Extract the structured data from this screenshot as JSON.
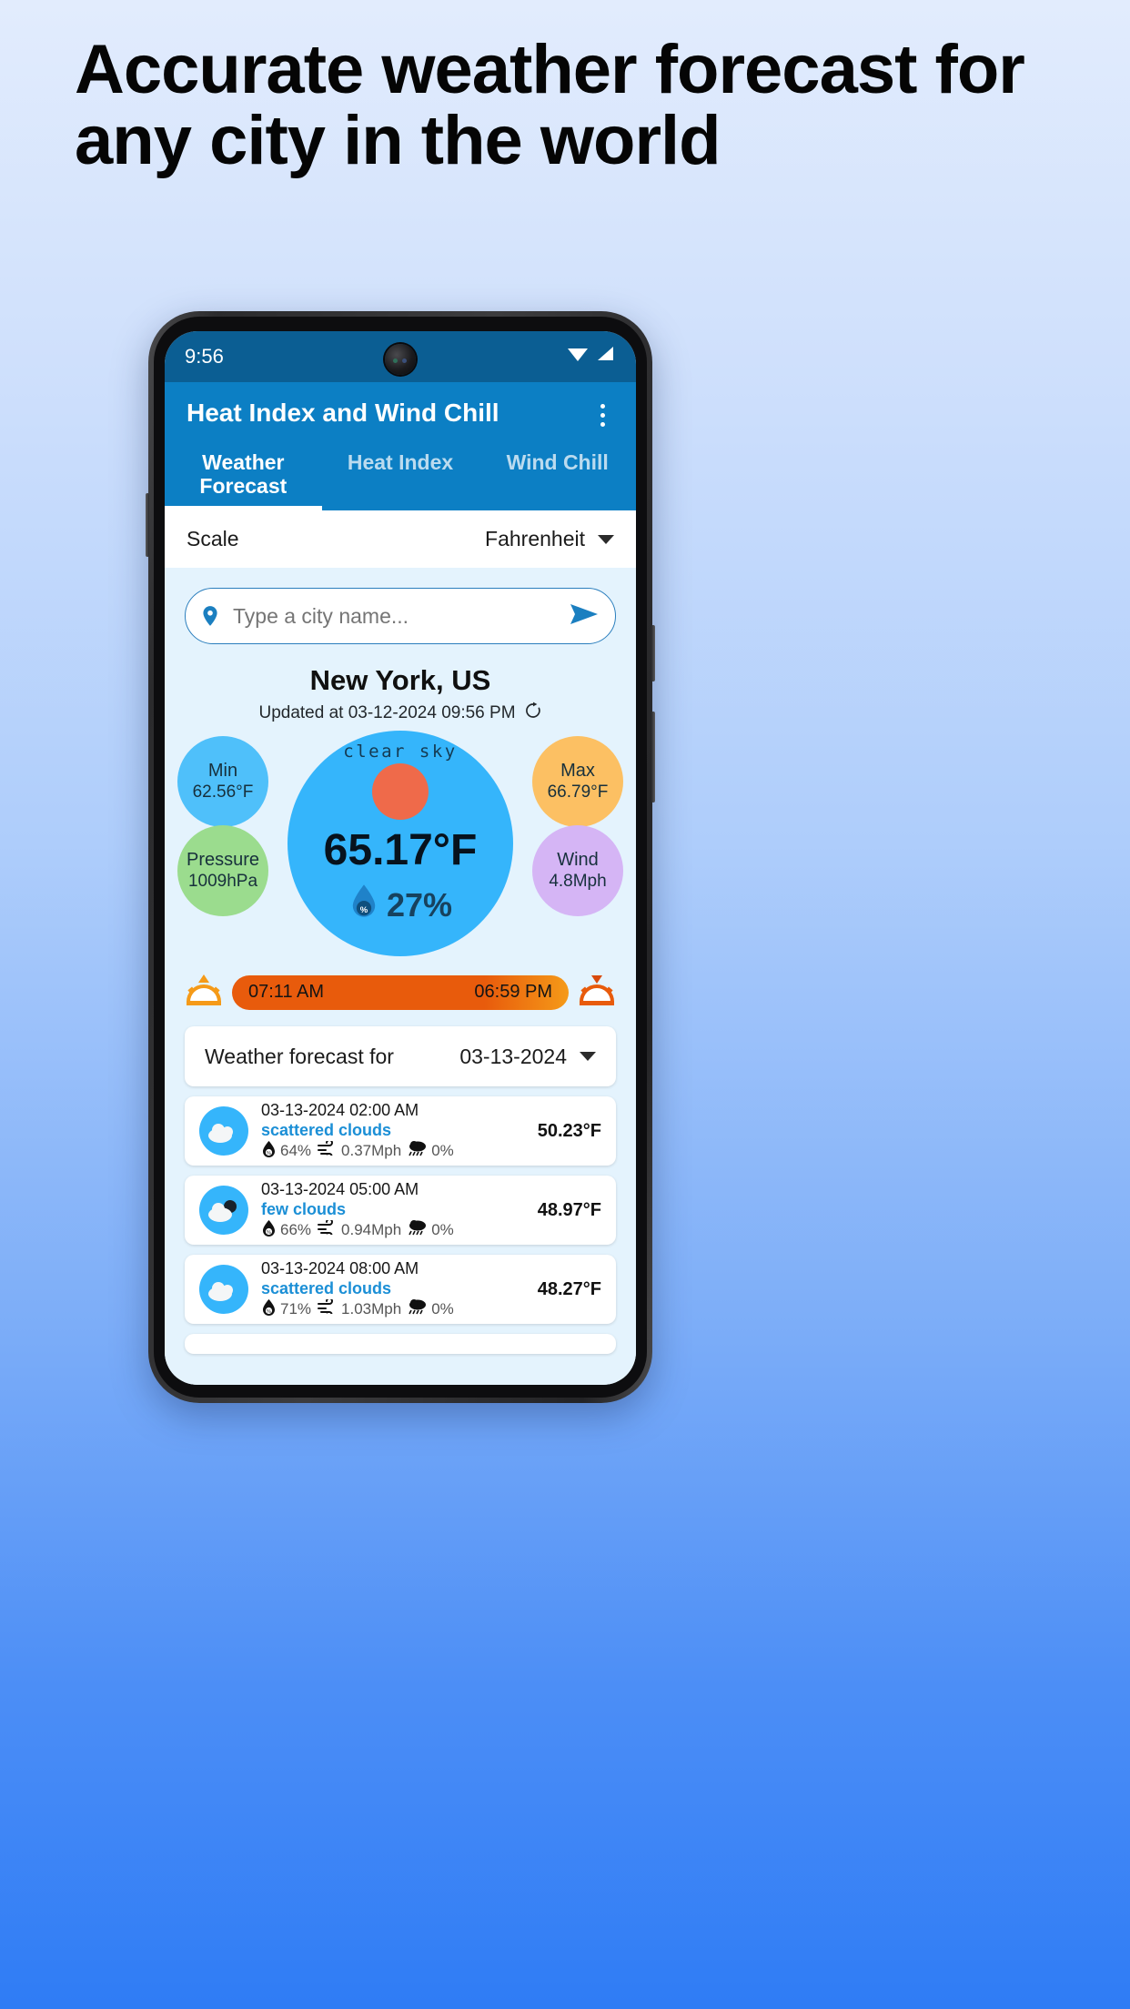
{
  "headline": "Accurate weather forecast for any city in the world",
  "phone": {
    "status": {
      "time": "9:56",
      "wifi_icon": "wifi-icon",
      "signal_icon": "cellular-signal-icon"
    },
    "appbar": {
      "title": "Heat Index and Wind Chill",
      "overflow_icon": "overflow-menu-icon"
    },
    "tabs": [
      {
        "label": "Weather Forecast",
        "active": true
      },
      {
        "label": "Heat Index",
        "active": false
      },
      {
        "label": "Wind Chill",
        "active": false
      }
    ],
    "scale_row": {
      "label": "Scale",
      "value": "Fahrenheit",
      "caret_icon": "chevron-down-icon"
    },
    "search": {
      "placeholder": "Type a city name...",
      "value": "",
      "pin_icon": "location-pin-icon",
      "send_icon": "send-icon"
    },
    "current": {
      "city": "New York, US",
      "updated": "Updated at 03-12-2024 09:56 PM",
      "refresh_icon": "refresh-icon",
      "condition": "clear sky",
      "temperature": "65.17°F",
      "humidity": "27%",
      "humidity_icon": "humidity-drop-icon",
      "bubbles": [
        {
          "title": "Min",
          "value": "62.56°F",
          "color": "#4fc0fa"
        },
        {
          "title": "Max",
          "value": "66.79°F",
          "color": "#fcc063"
        },
        {
          "title": "Pressure",
          "value": "1009hPa",
          "color": "#9bdc8e"
        },
        {
          "title": "Wind",
          "value": "4.8Mph",
          "color": "#d5b5f5"
        }
      ]
    },
    "sun": {
      "sunrise": "07:11 AM",
      "sunset": "06:59 PM",
      "sunrise_icon": "sunrise-icon",
      "sunset_icon": "sunset-icon"
    },
    "forecast_selector": {
      "label": "Weather forecast for",
      "date": "03-13-2024",
      "caret_icon": "chevron-down-icon"
    },
    "forecast_rows": [
      {
        "datetime": "03-13-2024 02:00 AM",
        "description": "scattered clouds",
        "humidity": "64%",
        "wind": "0.37Mph",
        "precip": "0%",
        "temp": "50.23°F",
        "icon": "scattered-clouds-icon"
      },
      {
        "datetime": "03-13-2024 05:00 AM",
        "description": "few clouds",
        "humidity": "66%",
        "wind": "0.94Mph",
        "precip": "0%",
        "temp": "48.97°F",
        "icon": "few-clouds-night-icon"
      },
      {
        "datetime": "03-13-2024 08:00 AM",
        "description": "scattered clouds",
        "humidity": "71%",
        "wind": "1.03Mph",
        "precip": "0%",
        "temp": "48.27°F",
        "icon": "scattered-clouds-icon"
      }
    ],
    "nav": {
      "pill_icon": "home-indicator"
    }
  },
  "colors": {
    "appbar": "#0c7fc4",
    "statusbar": "#0b5e93",
    "body": "#e4f3fd",
    "accent": "#35b5fb",
    "sunbar": "#e85b0c"
  }
}
